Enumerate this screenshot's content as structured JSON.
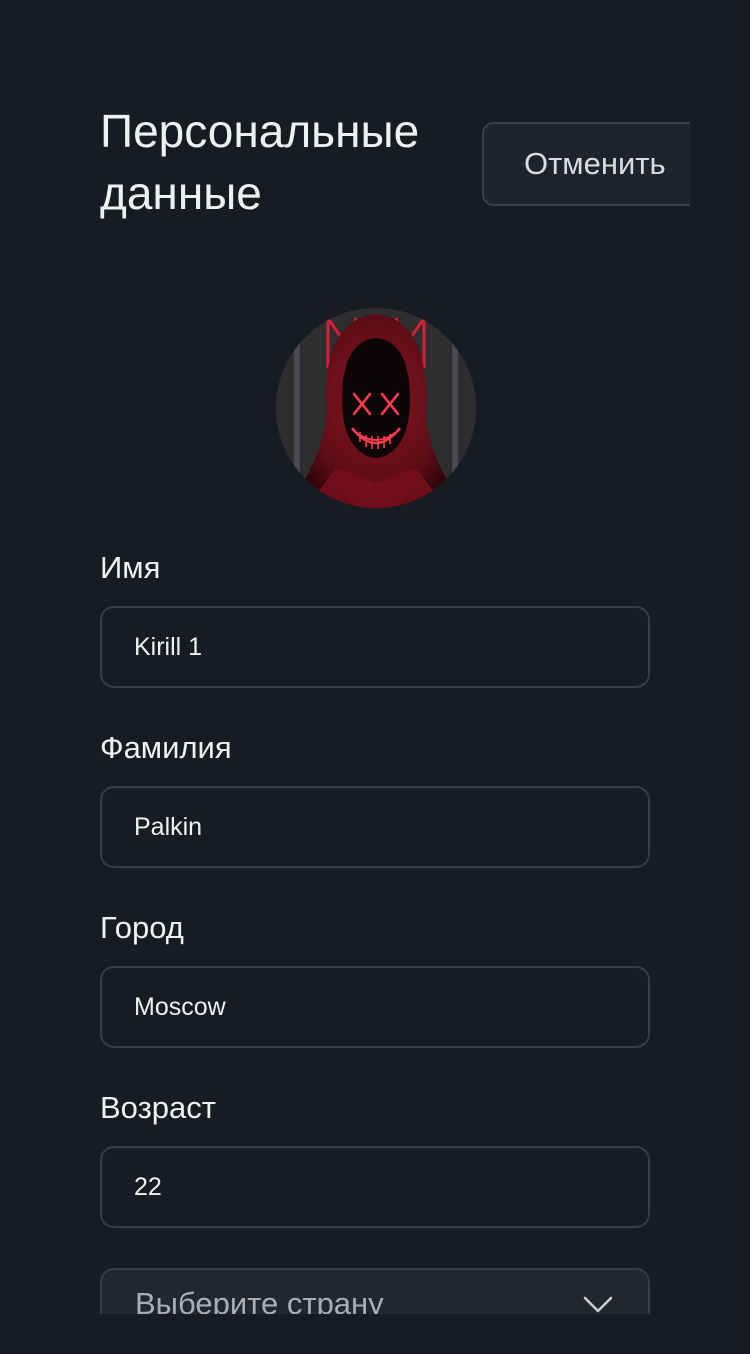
{
  "header": {
    "title": "Персональные данные",
    "cancel_label": "Отменить"
  },
  "fields": {
    "first_name": {
      "label": "Имя",
      "value": "Kirill 1"
    },
    "last_name": {
      "label": "Фамилия",
      "value": "Palkin"
    },
    "city": {
      "label": "Город",
      "value": "Moscow"
    },
    "age": {
      "label": "Возраст",
      "value": "22"
    }
  },
  "country_select": {
    "placeholder": "Выберите страну"
  },
  "icons": {
    "avatar": "hooded-figure-neon-mask-avatar",
    "select_chevron": "chevron-down-icon"
  },
  "colors": {
    "background": "#181c22",
    "input_border": "#383d45",
    "text": "#eef0f4",
    "avatar_accent": "#e0283c"
  }
}
